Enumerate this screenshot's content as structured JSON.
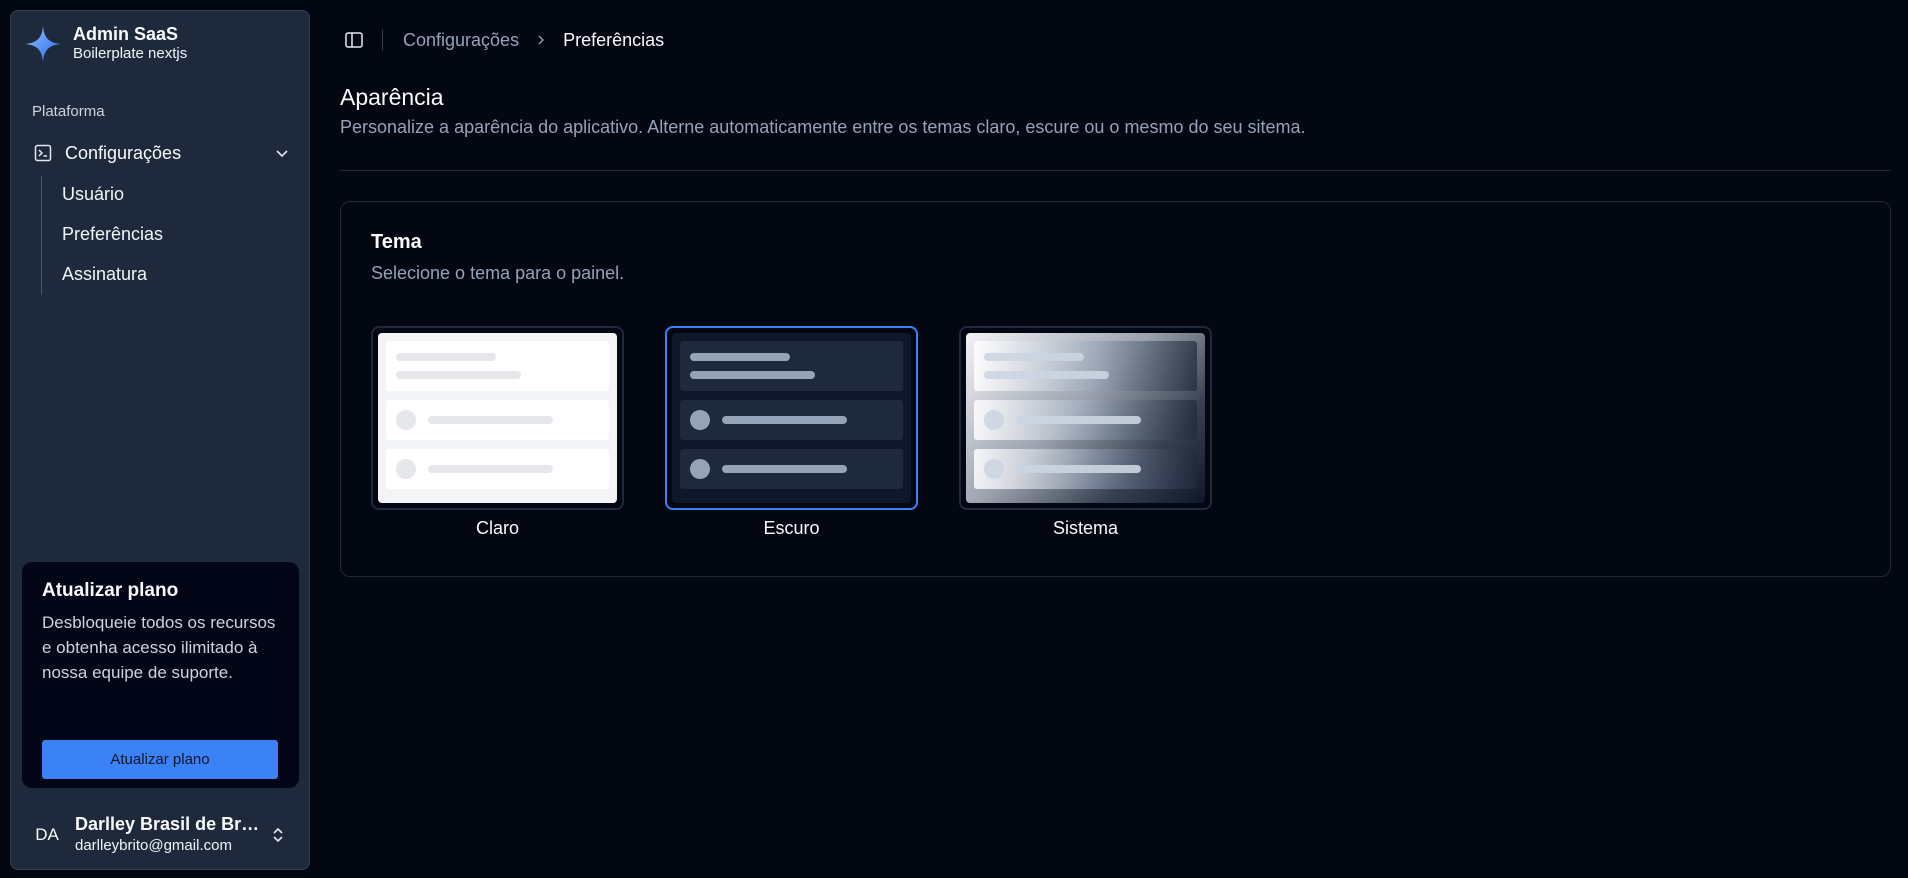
{
  "sidebar": {
    "brand": {
      "title": "Admin SaaS",
      "subtitle": "Boilerplate nextjs",
      "icon": "sparkle-icon"
    },
    "group_label": "Plataforma",
    "nav": {
      "parent": {
        "label": "Configurações",
        "icon": "terminal-square-icon"
      },
      "children": [
        {
          "label": "Usuário"
        },
        {
          "label": "Preferências"
        },
        {
          "label": "Assinatura"
        }
      ]
    },
    "upgrade": {
      "title": "Atualizar plano",
      "description": "Desbloqueie todos os recursos e obtenha acesso ilimitado à nossa equipe de suporte.",
      "button_label": "Atualizar plano"
    },
    "user": {
      "initials": "DA",
      "name": "Darlley Brasil de Brito",
      "email": "darlleybrito@gmail.com"
    }
  },
  "header": {
    "breadcrumb": {
      "parent": "Configurações",
      "current": "Preferências"
    }
  },
  "main": {
    "title": "Aparência",
    "description": "Personalize a aparência do aplicativo. Alterne automaticamente entre os temas claro, escure ou o mesmo do seu sitema.",
    "theme_card": {
      "title": "Tema",
      "description": "Selecione o tema para o painel.",
      "options": [
        {
          "label": "Claro",
          "selected": false
        },
        {
          "label": "Escuro",
          "selected": true
        },
        {
          "label": "Sistema",
          "selected": false
        }
      ]
    }
  },
  "colors": {
    "background": "#030712",
    "sidebar": "#1e293b",
    "accent": "#3b82f6",
    "muted_text": "#94a3b8"
  }
}
